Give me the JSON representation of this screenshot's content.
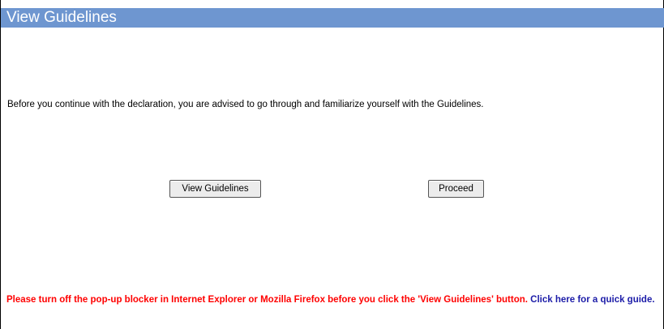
{
  "header": {
    "title": "View Guidelines"
  },
  "main": {
    "intro_text": "Before you continue with the declaration, you are advised to go through and familiarize yourself with the Guidelines.",
    "view_guidelines_label": "View Guidelines",
    "proceed_label": "Proceed"
  },
  "footer": {
    "warning_text": "Please turn off the pop-up blocker in Internet Explorer or Mozilla Firefox before you click the 'View Guidelines' button.",
    "link_text": "Click here for a quick guide."
  },
  "colors": {
    "title_bar_bg": "#6e96d0",
    "warning_red": "#ff0000",
    "link_blue": "#1c1ca8"
  }
}
